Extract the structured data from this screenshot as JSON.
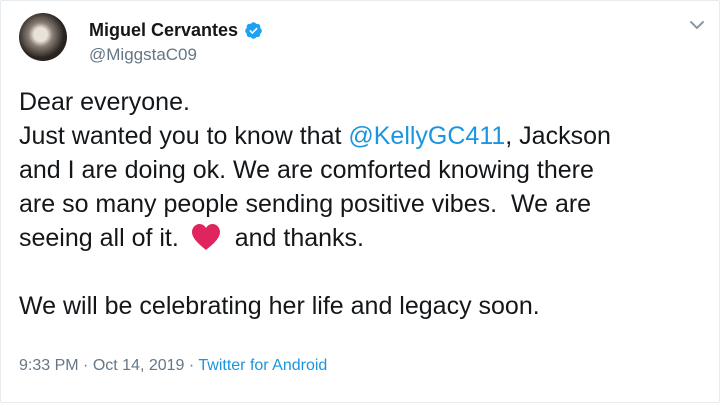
{
  "user": {
    "name": "Miguel Cervantes",
    "handle": "@MiggstaC09"
  },
  "tweet": {
    "line1": "Dear everyone.",
    "line2_pre": "Just wanted you to know that ",
    "mention": "@KellyGC411",
    "line2_post": ", Jackson",
    "line3": "and I are doing ok. We are comforted knowing there",
    "line4": "are so many people sending positive vibes.  We are",
    "line5_pre": "seeing all of it. ",
    "line5_post": " and thanks.",
    "line6": "We will be celebrating her life and legacy soon."
  },
  "meta": {
    "time": "9:33 PM",
    "sep1": " · ",
    "date": "Oct 14, 2019",
    "sep2": " · ",
    "source": "Twitter for Android"
  },
  "colors": {
    "accent": "#1b95e0",
    "heart": "#e0245e",
    "secondary": "#657786"
  },
  "icons": [
    "verified-badge-icon",
    "chevron-down-icon",
    "red-heart-emoji-icon"
  ]
}
